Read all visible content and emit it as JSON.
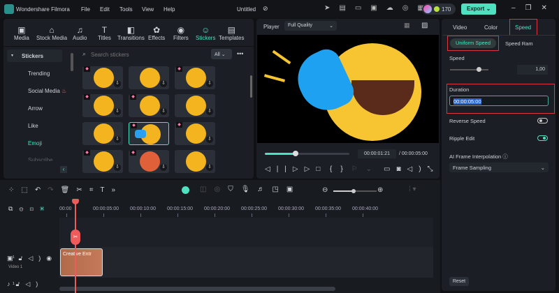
{
  "app": {
    "title": "Wondershare Filmora",
    "menu": [
      "File",
      "Edit",
      "Tools",
      "View",
      "Help"
    ],
    "project": "Untitled",
    "credits": "170",
    "export": "Export"
  },
  "media_tabs": [
    {
      "label": "Media",
      "icon": "media-icon"
    },
    {
      "label": "Stock Media",
      "icon": "stock-icon"
    },
    {
      "label": "Audio",
      "icon": "audio-icon"
    },
    {
      "label": "Titles",
      "icon": "titles-icon"
    },
    {
      "label": "Transitions",
      "icon": "transitions-icon"
    },
    {
      "label": "Effects",
      "icon": "effects-icon"
    },
    {
      "label": "Filters",
      "icon": "filters-icon"
    },
    {
      "label": "Stickers",
      "icon": "stickers-icon",
      "active": true
    },
    {
      "label": "Templates",
      "icon": "templates-icon"
    }
  ],
  "sidebar": {
    "header": "Stickers",
    "items": [
      "Trending",
      "Social Media",
      "Arrow",
      "Like",
      "Emoji",
      "Subscribe"
    ],
    "active": "Emoji"
  },
  "search": {
    "placeholder": "Search stickers",
    "filter": "All"
  },
  "player": {
    "label": "Player",
    "quality": "Full Quality",
    "current_time": "00:00:01:21",
    "total_time": "/ 00:00:05:00",
    "progress": 0.36
  },
  "props": {
    "tabs": [
      "Video",
      "Color",
      "Speed"
    ],
    "active_tab": "Speed",
    "subtabs": [
      "Uniform Speed",
      "Speed Ram"
    ],
    "speed_label": "Speed",
    "speed_value": "1,00",
    "duration_label": "Duration",
    "duration_value": "00:00:05:00",
    "reverse_label": "Reverse Speed",
    "reverse_on": false,
    "ripple_label": "Ripple Edit",
    "ripple_on": true,
    "ai_label": "AI Frame Interpolation",
    "ai_value": "Frame Sampling",
    "reset": "Reset"
  },
  "timeline": {
    "ticks": [
      "00:00",
      "00:00:05:00",
      "00:00:10:00",
      "00:00:15:00",
      "00:00:20:00",
      "00:00:25:00",
      "00:00:30:00",
      "00:00:35:00",
      "00:00:40:00"
    ],
    "clip_label": "Creative Entr",
    "video_track": "Video 1",
    "video_num": "1",
    "audio_num": "1"
  },
  "colors": {
    "accent": "#4fe0c0",
    "highlight": "#d9373f",
    "playhead": "#ef5b5b"
  }
}
